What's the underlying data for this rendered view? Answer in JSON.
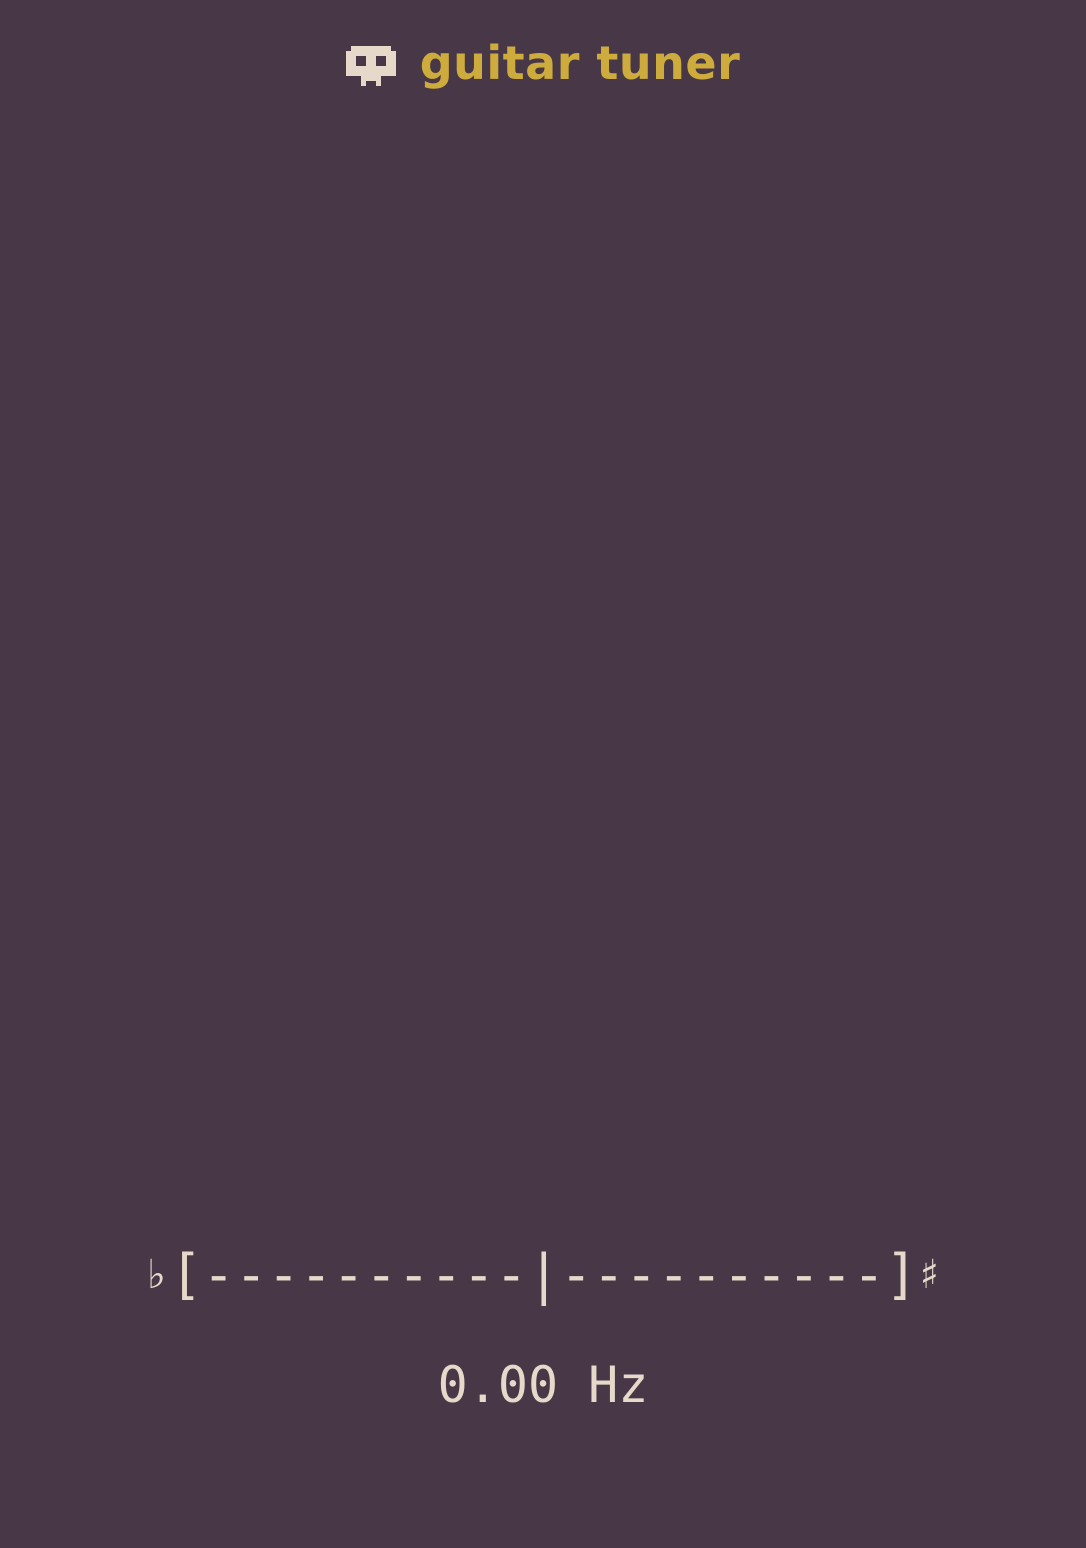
{
  "header": {
    "icon": "skull-icon",
    "title": "guitar tuner"
  },
  "tuner": {
    "flat_symbol": "♭",
    "left_bracket": "[",
    "left_scale": "----------",
    "needle": "|",
    "right_scale": "----------",
    "right_bracket": "]",
    "sharp_symbol": "♯",
    "frequency": "0.00 Hz"
  },
  "colors": {
    "background": "#473747",
    "accent": "#cdab3c",
    "text": "#e6d9ca"
  }
}
